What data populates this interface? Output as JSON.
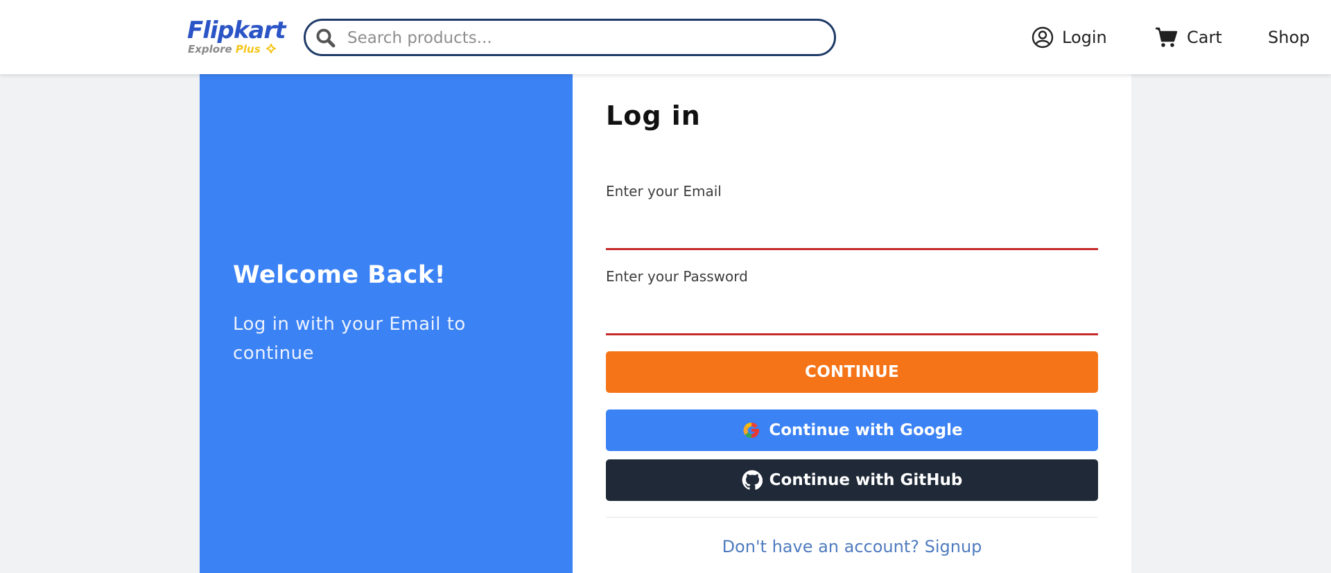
{
  "header": {
    "logo_text": "Flipkart",
    "logo_sub_explore": "Explore",
    "logo_sub_plus": "Plus",
    "search_placeholder": "Search products...",
    "nav": {
      "login": "Login",
      "cart": "Cart",
      "shop": "Shop"
    }
  },
  "welcome": {
    "title": "Welcome Back!",
    "subtitle": "Log in with your Email to continue"
  },
  "form": {
    "title": "Log in",
    "email_label": "Enter your Email",
    "email_value": "",
    "password_label": "Enter your Password",
    "password_value": "",
    "continue_label": "CONTINUE",
    "google_label": "Continue with Google",
    "github_label": "Continue with GitHub",
    "signup_text": "Don't have an account? Signup"
  },
  "colors": {
    "brand_blue": "#2b55c6",
    "panel_blue": "#3b82f4",
    "accent_orange": "#f57418",
    "github_dark": "#1f2937",
    "error_red": "#c62828",
    "link_blue": "#4f7bbf"
  },
  "icons": {
    "search": "search-icon",
    "user": "user-circle-icon",
    "cart": "cart-icon",
    "google": "google-icon",
    "github": "github-icon"
  }
}
